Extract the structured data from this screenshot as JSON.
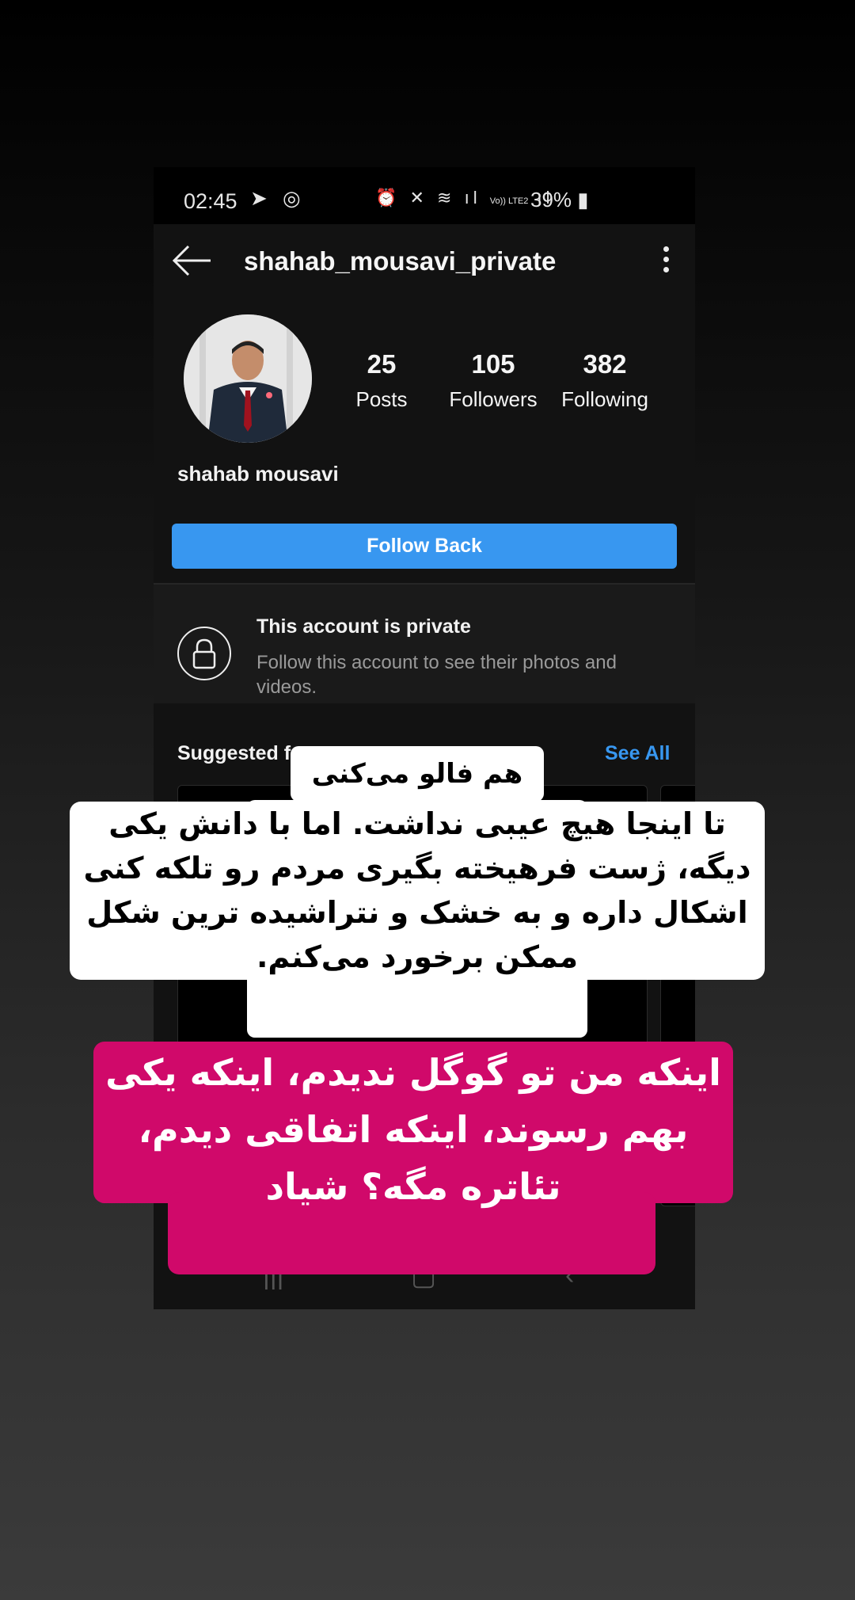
{
  "status_bar": {
    "time": "02:45",
    "left_icons": [
      "telegram-icon",
      "whatsapp-icon"
    ],
    "right_icons": [
      "alarm-icon",
      "mute-icon",
      "wifi-icon",
      "signal-icon",
      "volte-icon",
      "signal-icon"
    ],
    "volte_label": "Vo)) LTE2",
    "battery": "39%"
  },
  "header": {
    "username": "shahab_mousavi_private"
  },
  "profile": {
    "display_name": "shahab mousavi",
    "stats": [
      {
        "value": "25",
        "label": "Posts"
      },
      {
        "value": "105",
        "label": "Followers"
      },
      {
        "value": "382",
        "label": "Following"
      }
    ],
    "follow_button": "Follow Back"
  },
  "private_notice": {
    "title": "This account is private",
    "subtitle": "Follow this account to see their photos and videos."
  },
  "suggested": {
    "label": "Suggested f",
    "see_all": "See All"
  },
  "stickers": {
    "top": "هم فالو می‌کنی",
    "middle": "تا اینجا هیچ عیبی نداشت. اما با دانش یکی دیگه، ژست فرهیخته بگیری مردم رو تلکه کنی اشکال داره و به خشک و نتراشیده ترین شکل ممکن برخورد می‌کنم.",
    "pink": "اینکه من تو گوگل ندیدم، اینکه یکی بهم رسوند، اینکه اتفاقی دیدم، تئاتره مگه؟ شیاد"
  },
  "colors": {
    "accent": "#3897f0",
    "pink": "#d0096a",
    "background": "#121212"
  }
}
